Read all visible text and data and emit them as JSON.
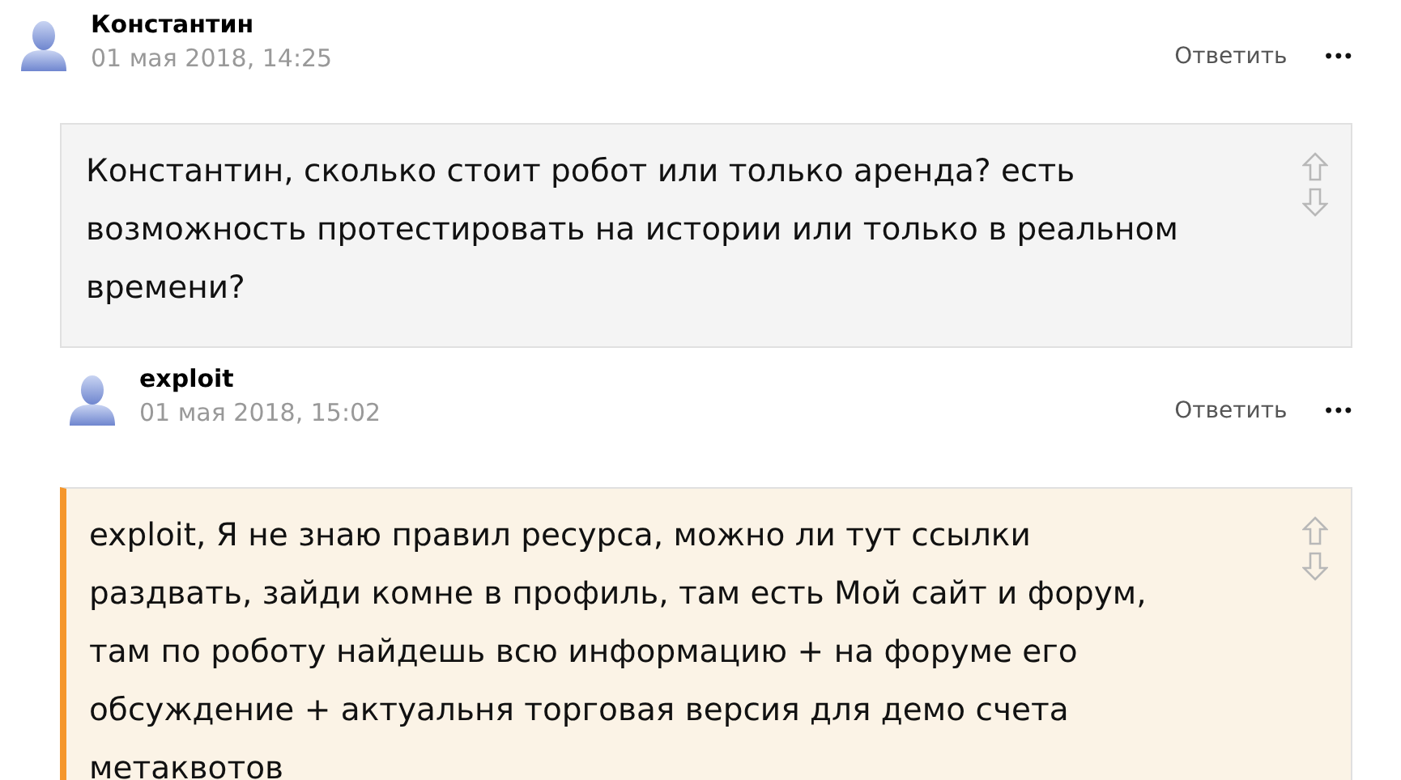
{
  "comments": [
    {
      "author": "Константин",
      "date": "01 мая 2018, 14:25",
      "reply": "Ответить",
      "more": "•••",
      "highlighted": false,
      "text": "Константин, сколько стоит робот или только аренда? есть\nвозможность протестировать на истории или только в реальном\nвремени?",
      "children": [
        {
          "author": "exploit",
          "date": "01 мая 2018, 15:02",
          "reply": "Ответить",
          "more": "•••",
          "highlighted": true,
          "text": "exploit, Я не знаю правил ресурса, можно ли тут ссылки\nраздвать, зайди комне в профиль, там есть Мой сайт и форум,\nтам по роботу найдешь всю информацию + на форуме его\nобсуждение + актуальня торговая версия для демо счета\nметаквотов"
        }
      ]
    }
  ]
}
